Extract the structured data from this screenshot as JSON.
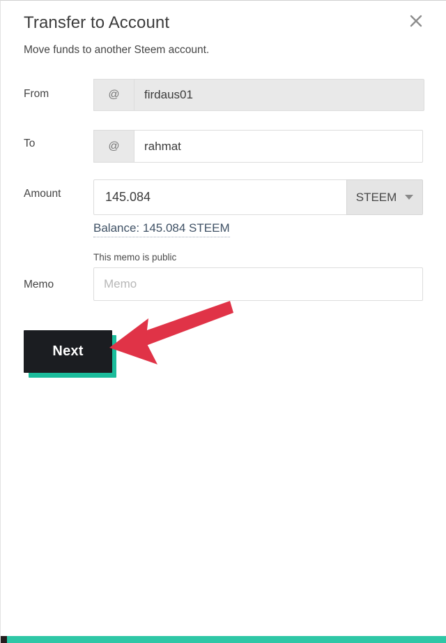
{
  "modal": {
    "title": "Transfer to Account",
    "subtitle": "Move funds to another Steem account.",
    "close_label": "×"
  },
  "form": {
    "from": {
      "label": "From",
      "prefix": "@",
      "value": "firdaus01",
      "placeholder": "",
      "disabled": true
    },
    "to": {
      "label": "To",
      "prefix": "@",
      "value": "rahmat",
      "placeholder": "",
      "disabled": false
    },
    "amount": {
      "label": "Amount",
      "value": "145.084",
      "placeholder": "",
      "currency": "STEEM",
      "balance_link": "Balance: 145.084 STEEM"
    },
    "memo": {
      "label": "Memo",
      "note": "This memo is public",
      "value": "",
      "placeholder": "Memo"
    }
  },
  "actions": {
    "next_label": "Next"
  },
  "colors": {
    "accent_teal": "#1bbc9b",
    "bottom_bar": "#2ec7a6",
    "button_dark": "#1b1d21",
    "annotation_red": "#e03347",
    "link_slate": "#3f5165"
  }
}
